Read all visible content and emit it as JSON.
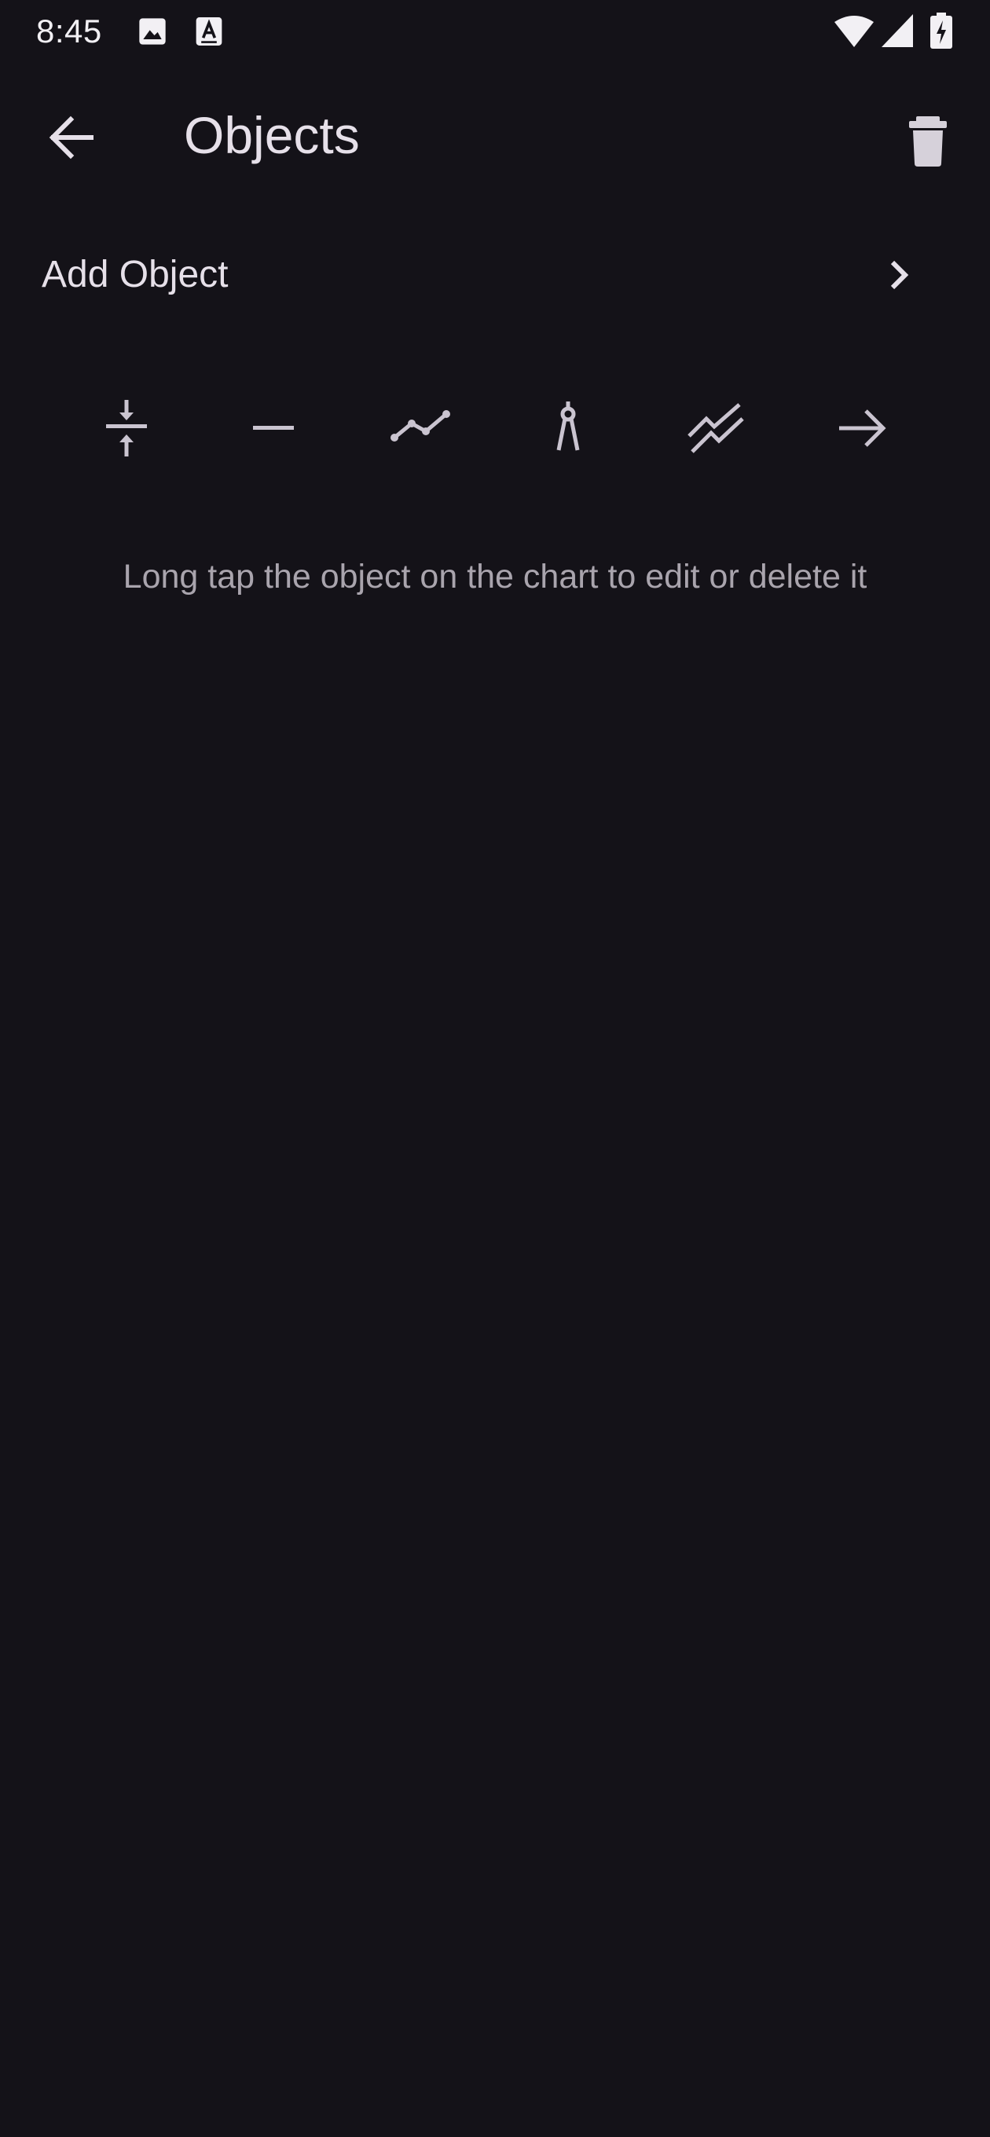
{
  "status_bar": {
    "time": "8:45",
    "icons": [
      "image-icon",
      "text-a-icon",
      "wifi-icon",
      "cellular-signal-icon",
      "battery-charging-icon"
    ]
  },
  "app_bar": {
    "title": "Objects",
    "back_icon": "arrow-back-icon",
    "delete_icon": "trash-icon"
  },
  "add_object": {
    "label": "Add Object",
    "chevron_icon": "chevron-right-icon"
  },
  "tools": [
    {
      "icon": "vertical-align-center-icon"
    },
    {
      "icon": "horizontal-line-icon"
    },
    {
      "icon": "trend-line-icon"
    },
    {
      "icon": "compass-icon"
    },
    {
      "icon": "parallel-lines-icon"
    },
    {
      "icon": "arrow-right-icon"
    }
  ],
  "hint": "Long tap the object on the chart to edit or delete it",
  "colors": {
    "background": "#141218",
    "text_primary": "#E6E0E9",
    "text_secondary": "#A9A4AD",
    "icon": "#CAC4D0"
  }
}
